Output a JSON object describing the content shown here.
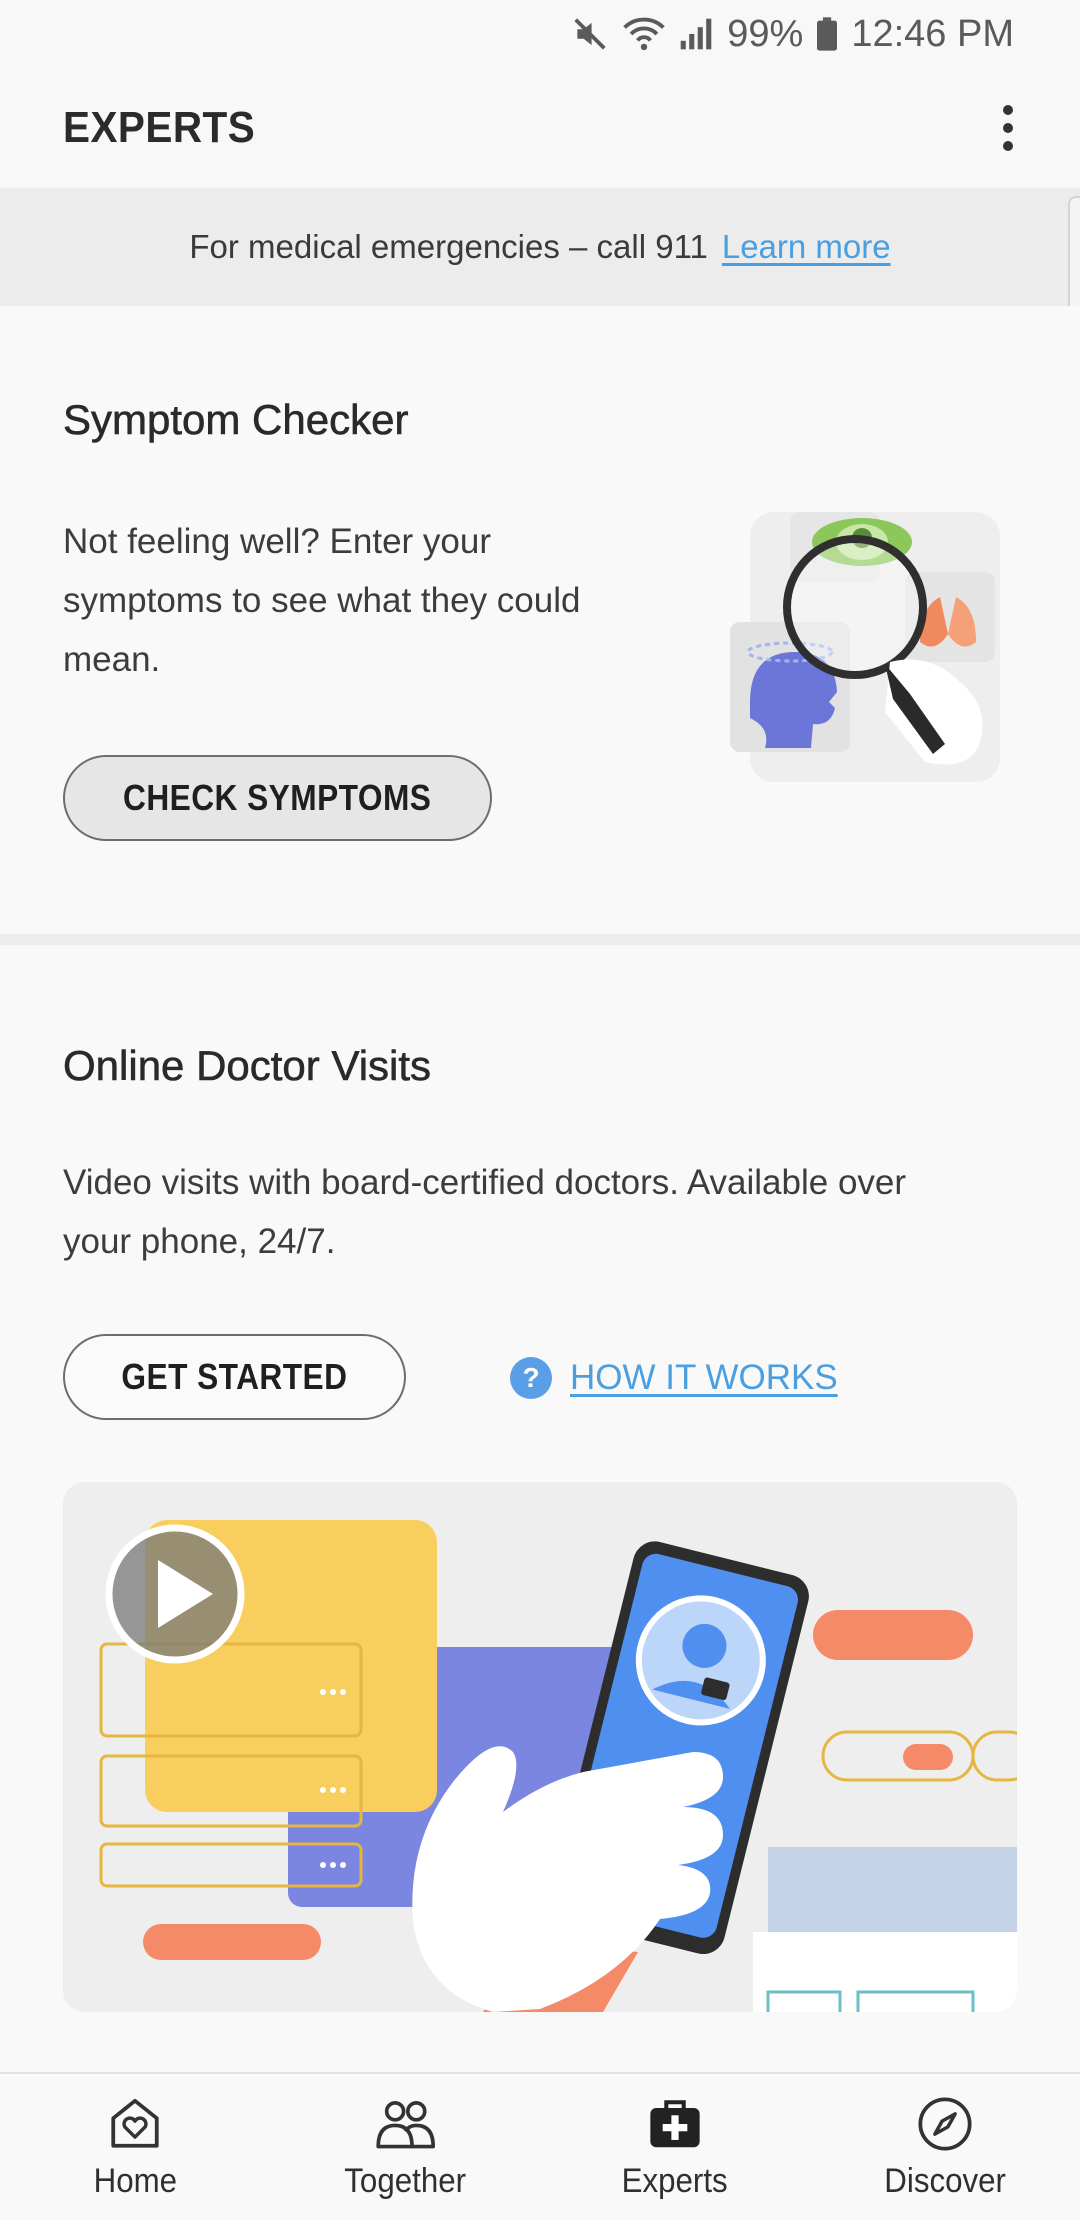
{
  "status_bar": {
    "battery": "99%",
    "time": "12:46 PM",
    "icons": [
      "mute-icon",
      "wifi-icon",
      "signal-icon",
      "battery-icon"
    ]
  },
  "app_bar": {
    "title": "EXPERTS",
    "menu_icon": "more-vert-icon"
  },
  "banner": {
    "text": "For medical emergencies – call 911",
    "link": "Learn more",
    "link_color": "#4a9fe0"
  },
  "symptom_checker": {
    "title": "Symptom Checker",
    "description": "Not feeling well? Enter your symptoms to see what they could mean.",
    "button": "CHECK SYMPTOMS",
    "illustration": "symptom-magnifier-illustration"
  },
  "doctor_visits": {
    "title": "Online Doctor Visits",
    "description": "Video visits with board-certified doctors. Available over your phone, 24/7.",
    "button": "GET STARTED",
    "help_icon_glyph": "?",
    "help_link": "HOW IT WORKS",
    "video_icon": "play-icon"
  },
  "bottom_nav": {
    "items": [
      {
        "label": "Home",
        "icon": "heart-home-icon"
      },
      {
        "label": "Together",
        "icon": "people-icon"
      },
      {
        "label": "Experts",
        "icon": "medical-bag-icon",
        "active": true
      },
      {
        "label": "Discover",
        "icon": "compass-icon"
      }
    ]
  },
  "colors": {
    "accent": "#4a9fe0",
    "background": "#f8f8f8",
    "banner_bg": "#ececec"
  }
}
